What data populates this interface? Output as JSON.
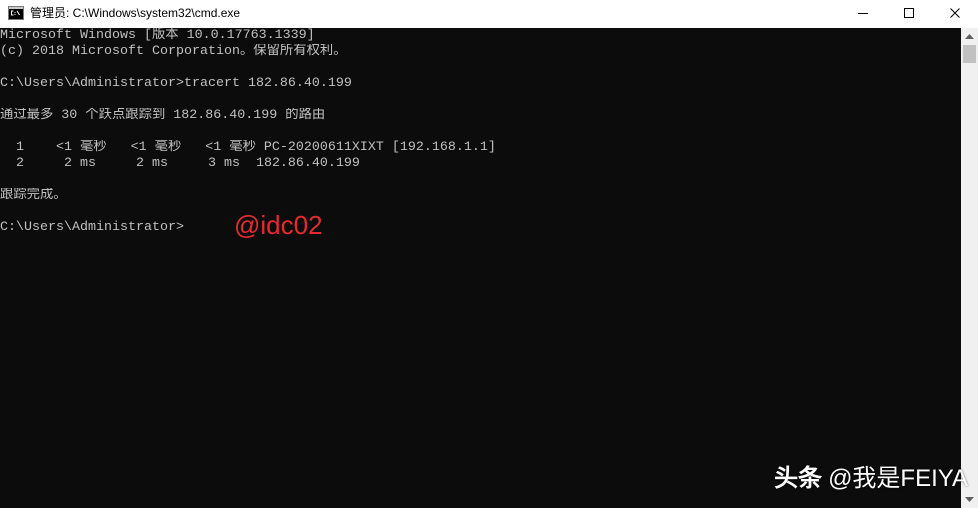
{
  "window": {
    "title": "管理员: C:\\Windows\\system32\\cmd.exe",
    "icons": {
      "app": "cmd-icon",
      "minimize": "minimize-icon",
      "maximize": "maximize-icon",
      "close": "close-icon"
    }
  },
  "console": {
    "lines": [
      "Microsoft Windows [版本 10.0.17763.1339]",
      "(c) 2018 Microsoft Corporation。保留所有权利。",
      "C:\\Users\\Administrator>tracert 182.86.40.199",
      "通过最多 30 个跃点跟踪到 182.86.40.199 的路由",
      "  1    <1 毫秒   <1 毫秒   <1 毫秒 PC-20200611XIXT [192.168.1.1]",
      "  2     2 ms     2 ms     3 ms  182.86.40.199",
      "跟踪完成。",
      "C:\\Users\\Administrator>"
    ]
  },
  "scrollbar": {
    "icons": {
      "up": "scroll-up-arrow-icon",
      "down": "scroll-down-arrow-icon"
    }
  },
  "watermarks": {
    "overlay": "@idc02",
    "footer_brand": "头条",
    "footer_handle": "@我是FEIYA"
  },
  "colors": {
    "titlebar_bg": "#ffffff",
    "console_bg": "#0c0c0c",
    "console_text": "#c0c0c0",
    "scrollbar_track": "#f0f0f0",
    "scrollbar_thumb": "#c1c1c1",
    "overlay_watermark": "#e52a2f",
    "footer_watermark": "#ffffff"
  }
}
